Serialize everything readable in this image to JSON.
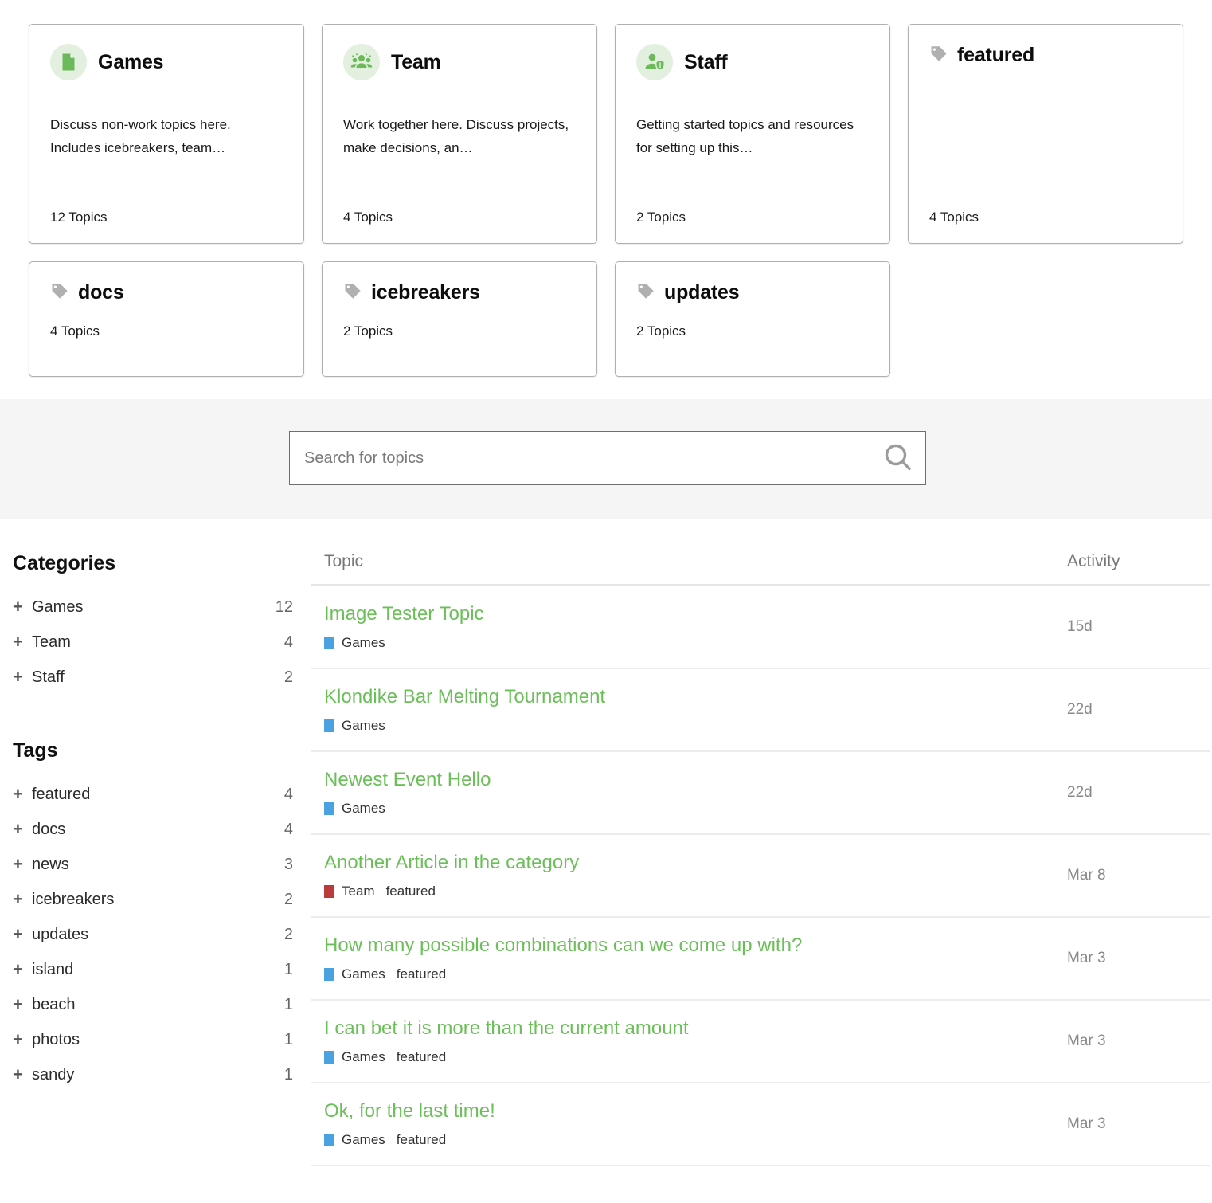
{
  "cards": {
    "row1": [
      {
        "kind": "category",
        "icon": "document-icon",
        "title": "Games",
        "description": "Discuss non-work topics here. Includes icebreakers, team…",
        "topics": "12 Topics"
      },
      {
        "kind": "category",
        "icon": "group-people-icon",
        "title": "Team",
        "description": "Work together here. Discuss projects, make decisions, an…",
        "topics": "4 Topics"
      },
      {
        "kind": "category",
        "icon": "person-shield-icon",
        "title": "Staff",
        "description": "Getting started topics and resources for setting up this…",
        "topics": "2 Topics"
      },
      {
        "kind": "tag",
        "icon": "tag-icon",
        "title": "featured",
        "description": "",
        "topics": "4 Topics"
      }
    ],
    "row2": [
      {
        "kind": "tag",
        "icon": "tag-icon",
        "title": "docs",
        "topics": "4 Topics"
      },
      {
        "kind": "tag",
        "icon": "tag-icon",
        "title": "icebreakers",
        "topics": "2 Topics"
      },
      {
        "kind": "tag",
        "icon": "tag-icon",
        "title": "updates",
        "topics": "2 Topics"
      }
    ]
  },
  "search": {
    "placeholder": "Search for topics",
    "value": "",
    "icon": "search-icon"
  },
  "sidebar": {
    "categories_heading": "Categories",
    "categories": [
      {
        "label": "Games",
        "count": "12"
      },
      {
        "label": "Team",
        "count": "4"
      },
      {
        "label": "Staff",
        "count": "2"
      }
    ],
    "tags_heading": "Tags",
    "tags": [
      {
        "label": "featured",
        "count": "4"
      },
      {
        "label": "docs",
        "count": "4"
      },
      {
        "label": "news",
        "count": "3"
      },
      {
        "label": "icebreakers",
        "count": "2"
      },
      {
        "label": "updates",
        "count": "2"
      },
      {
        "label": "island",
        "count": "1"
      },
      {
        "label": "beach",
        "count": "1"
      },
      {
        "label": "photos",
        "count": "1"
      },
      {
        "label": "sandy",
        "count": "1"
      }
    ],
    "expand_glyph": "+"
  },
  "topic_table": {
    "col_topic": "Topic",
    "col_activity": "Activity",
    "rows": [
      {
        "title": "Image Tester Topic",
        "category": "Games",
        "category_color": "#4aa3e0",
        "tags": [],
        "activity": "15d"
      },
      {
        "title": "Klondike Bar Melting Tournament",
        "category": "Games",
        "category_color": "#4aa3e0",
        "tags": [],
        "activity": "22d"
      },
      {
        "title": "Newest Event Hello",
        "category": "Games",
        "category_color": "#4aa3e0",
        "tags": [],
        "activity": "22d"
      },
      {
        "title": "Another Article in the category",
        "category": "Team",
        "category_color": "#b93b3b",
        "tags": [
          "featured"
        ],
        "activity": "Mar 8"
      },
      {
        "title": "How many possible combinations can we come up with?",
        "category": "Games",
        "category_color": "#4aa3e0",
        "tags": [
          "featured"
        ],
        "activity": "Mar 3"
      },
      {
        "title": "I can bet it is more than the current amount",
        "category": "Games",
        "category_color": "#4aa3e0",
        "tags": [
          "featured"
        ],
        "activity": "Mar 3"
      },
      {
        "title": "Ok, for the last time!",
        "category": "Games",
        "category_color": "#4aa3e0",
        "tags": [
          "featured"
        ],
        "activity": "Mar 3"
      }
    ]
  },
  "colors": {
    "link_green": "#6bbf59",
    "icon_green": "#6cb95c",
    "icon_bg": "#e3f0e0",
    "tag_gray": "#b0b0b0",
    "band_gray": "#f5f5f5"
  }
}
